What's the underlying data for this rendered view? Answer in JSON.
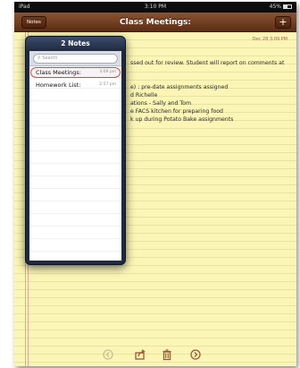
{
  "status": {
    "carrier": "iPad",
    "time": "3:10 PM",
    "battery": "45%"
  },
  "nav": {
    "back_label": "Notes",
    "title": "Class Meetings:",
    "add_label": "+"
  },
  "note": {
    "date": "Dec 28   3:09 PM",
    "lines": [
      "ssed out for review.  Student will report on comments at",
      "",
      "",
      "e) : pre-date assignments assigned",
      "d Richelle",
      "ations - Sally and Tom",
      "e FACS kitchen for preparing food",
      "k up during Potato Bake assignments"
    ]
  },
  "popover": {
    "title": "2 Notes",
    "search_placeholder": "Search",
    "notes": [
      {
        "title": "Class Meetings:",
        "time": "3:09 pm",
        "selected": true
      },
      {
        "title": "Homework List:",
        "time": "2:57 pm",
        "selected": false
      }
    ]
  },
  "toolbar": {
    "previous_icon": "left-arrow-icon",
    "share_icon": "share-icon",
    "delete_icon": "trash-icon",
    "next_icon": "right-arrow-icon",
    "accent_color": "#9a5a38"
  }
}
